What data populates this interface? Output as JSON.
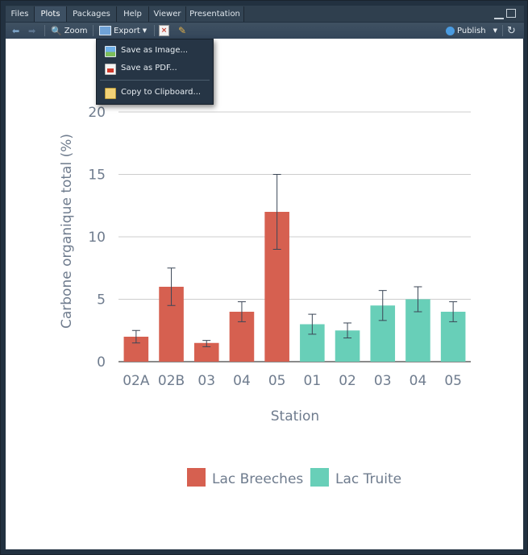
{
  "tabs": [
    {
      "label": "Files",
      "active": false
    },
    {
      "label": "Plots",
      "active": true
    },
    {
      "label": "Packages",
      "active": false
    },
    {
      "label": "Help",
      "active": false
    },
    {
      "label": "Viewer",
      "active": false
    },
    {
      "label": "Presentation",
      "active": false
    }
  ],
  "toolbar": {
    "zoom_label": "Zoom",
    "export_label": "Export",
    "publish_label": "Publish"
  },
  "export_menu": {
    "items": [
      "Save as Image...",
      "Save as PDF...",
      "Copy to Clipboard..."
    ]
  },
  "colors": {
    "breeches": "#d66050",
    "truite": "#68cfb8",
    "text": "#6f7c8e",
    "grid": "#cccccc"
  },
  "chart_data": {
    "type": "bar",
    "xlabel": "Station",
    "ylabel": "Carbone organique total (%)",
    "ylim": [
      0,
      20
    ],
    "yticks": [
      0,
      5,
      10,
      15,
      20
    ],
    "grid": true,
    "legend_position": "bottom",
    "categories": [
      "02A",
      "02B",
      "03",
      "04",
      "05",
      "01",
      "02",
      "03",
      "04",
      "05"
    ],
    "values": [
      2.0,
      6.0,
      1.5,
      4.0,
      12.0,
      3.0,
      2.5,
      4.5,
      5.0,
      4.0
    ],
    "error_low": [
      1.5,
      4.5,
      1.2,
      3.2,
      9.0,
      2.2,
      1.9,
      3.3,
      4.0,
      3.2
    ],
    "error_high": [
      2.5,
      7.5,
      1.7,
      4.8,
      15.0,
      3.8,
      3.1,
      5.7,
      6.0,
      4.8
    ],
    "group": [
      "Lac Breeches",
      "Lac Breeches",
      "Lac Breeches",
      "Lac Breeches",
      "Lac Breeches",
      "Lac Truite",
      "Lac Truite",
      "Lac Truite",
      "Lac Truite",
      "Lac Truite"
    ],
    "series": [
      {
        "name": "Lac Breeches",
        "color": "#d66050"
      },
      {
        "name": "Lac Truite",
        "color": "#68cfb8"
      }
    ]
  }
}
